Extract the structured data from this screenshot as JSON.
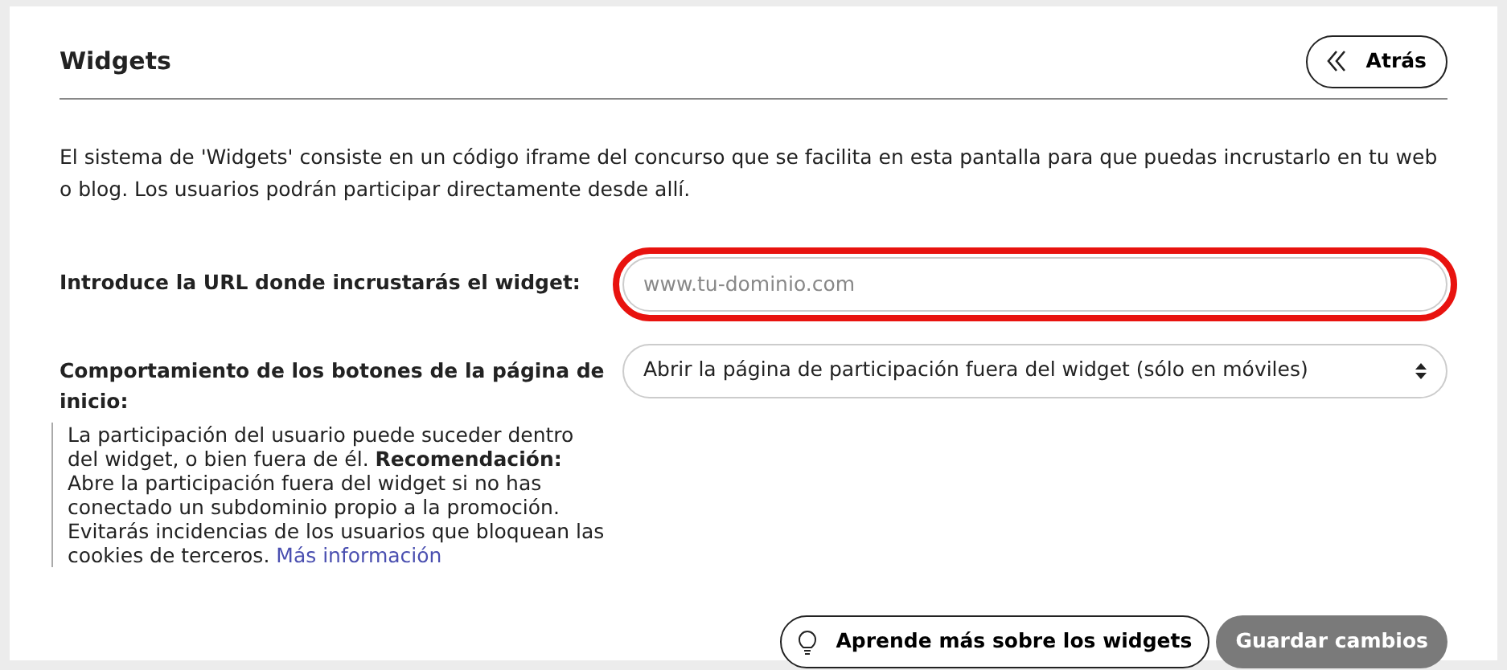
{
  "header": {
    "title": "Widgets",
    "back_button": "Atrás"
  },
  "description": "El sistema de 'Widgets' consiste en un código iframe del concurso que se facilita en esta pantalla para que puedas incrustarlo en tu web o blog. Los usuarios podrán participar directamente desde allí.",
  "url_field": {
    "label": "Introduce la URL donde incrustarás el widget:",
    "placeholder": "www.tu-dominio.com",
    "highlighted": true
  },
  "behavior_field": {
    "label": "Comportamiento de los botones de la página de inicio:",
    "value": "Abrir la página de participación fuera del widget (sólo en móviles)",
    "help": "La participación del usuario puede suceder dentro del widget, o bien fuera de él. **Recomendación:** Abre la participación fuera del widget si no has conectado un subdominio propio a la promoción. Evitarás incidencias de los usuarios que bloquean las cookies de terceros.",
    "help_link": "Más información"
  },
  "buttons": {
    "learn": "Aprende más sobre los widgets",
    "save": {
      "label": "Guardar cambios",
      "disabled": true
    }
  }
}
